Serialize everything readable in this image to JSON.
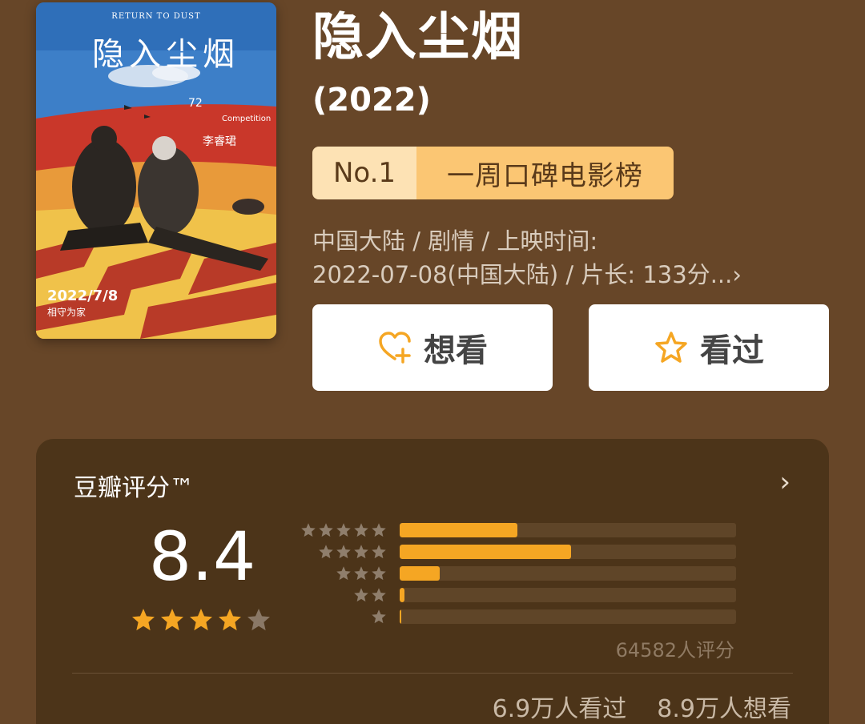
{
  "poster": {
    "english_title": "RETURN TO DUST",
    "chinese_title": "隐入尘烟",
    "badge_number": "72",
    "badge_label": "Competition",
    "director": "李睿珺",
    "date": "2022/7/8",
    "tagline": "相守为家"
  },
  "movie": {
    "title": "隐入尘烟",
    "year": "(2022)"
  },
  "rank": {
    "number": "No.1",
    "name": "一周口碑电影榜"
  },
  "meta": {
    "line1": "中国大陆 / 剧情 / 上映时间:",
    "line2": "2022-07-08(中国大陆) / 片长:  133分...",
    "chevron": "›"
  },
  "actions": {
    "want_label": "想看",
    "seen_label": "看过"
  },
  "rating": {
    "title": "豆瓣评分™",
    "chevron": "›",
    "score": "8.4",
    "stars_filled": 4,
    "stars_total": 5,
    "distribution": [
      {
        "stars": 5,
        "percent": 35
      },
      {
        "stars": 4,
        "percent": 51
      },
      {
        "stars": 3,
        "percent": 12
      },
      {
        "stars": 2,
        "percent": 1.5
      },
      {
        "stars": 1,
        "percent": 0.5
      }
    ],
    "votes": "64582人评分",
    "seen_count": "6.9万人看过",
    "want_count": "8.9万人想看"
  },
  "colors": {
    "background": "#674628",
    "card": "#4c3419",
    "accent": "#f5a623",
    "rank_light": "#fde2b4",
    "rank_dark": "#fbc673"
  }
}
